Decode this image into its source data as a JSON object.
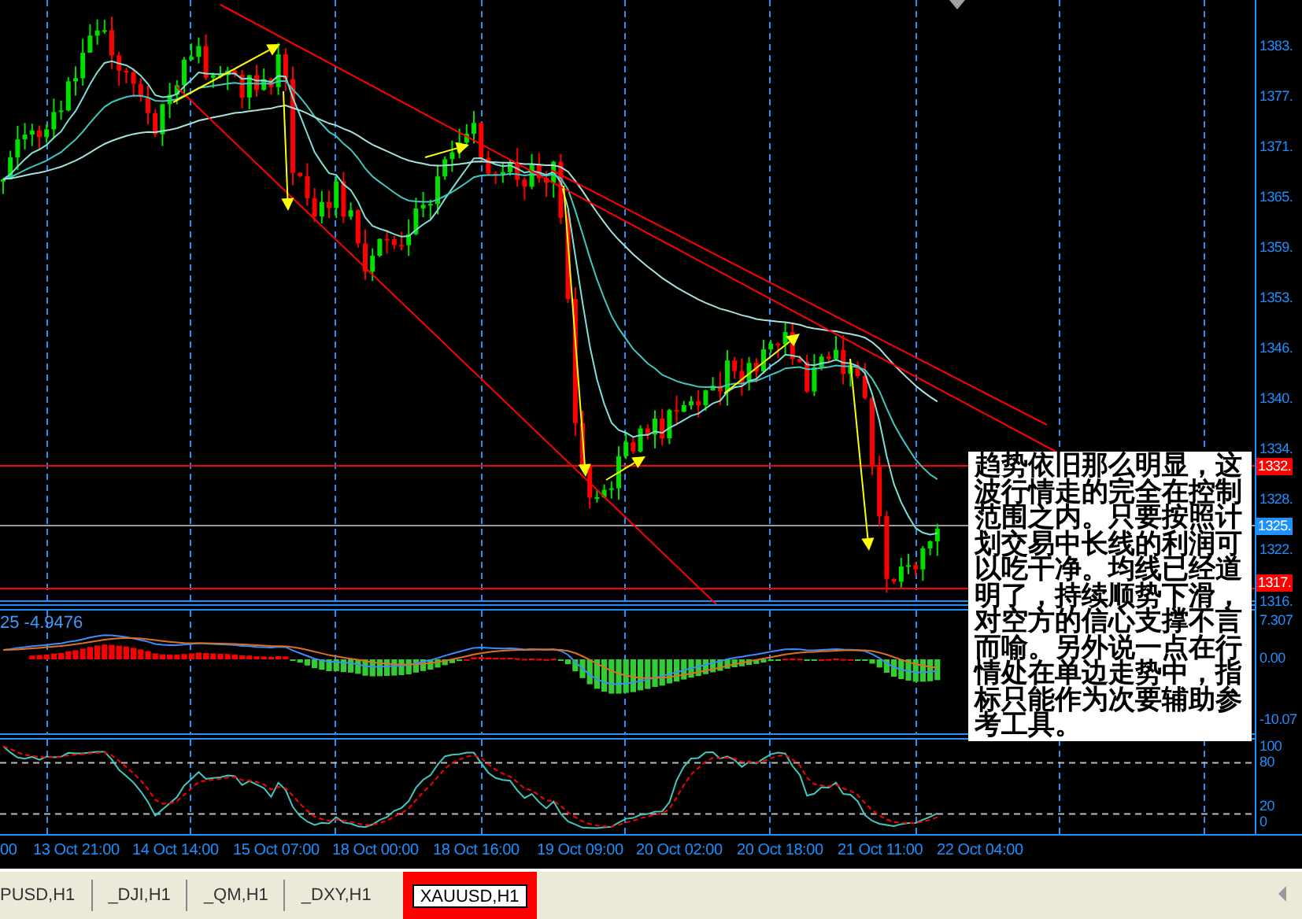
{
  "price_axis": {
    "ticks": [
      "1383.",
      "1377.",
      "1371.",
      "1365.",
      "1359.",
      "1353.",
      "1346.",
      "1340.",
      "1334.",
      "1328.",
      "1322.",
      "1316."
    ],
    "markers": [
      {
        "text": "1332.",
        "color": "#ff0000"
      },
      {
        "text": "1325.",
        "color": "#1e90ff"
      },
      {
        "text": "1317.",
        "color": "#ff0000"
      }
    ]
  },
  "macd": {
    "label": "25 -4.9476",
    "axis": [
      "7.307",
      "0.00",
      "-10.07"
    ]
  },
  "stochastic": {
    "axis": [
      "100",
      "80",
      "20",
      "0"
    ]
  },
  "time_axis": [
    "00",
    "13 Oct 21:00",
    "14 Oct 14:00",
    "15 Oct 07:00",
    "18 Oct 00:00",
    "18 Oct 16:00",
    "19 Oct 09:00",
    "20 Oct 02:00",
    "20 Oct 18:00",
    "21 Oct 11:00",
    "22 Oct 04:00"
  ],
  "note": "趋势依旧那么明显，这波行情走的完全在控制范围之内。只要按照计划交易中长线的利润可以吃干净。均线已经道明了，持续顺势下滑，对空方的信心支撑不言而喻。另外说一点在行情处在单边走势中，指标只能作为次要辅助参考工具。",
  "tabs": [
    {
      "label": "PUSD,H1",
      "selected": false
    },
    {
      "label": "_DJI,H1",
      "selected": false
    },
    {
      "label": "_QM,H1",
      "selected": false
    },
    {
      "label": "_DXY,H1",
      "selected": false
    },
    {
      "label": "XAUUSD,H1",
      "selected": true
    }
  ]
}
